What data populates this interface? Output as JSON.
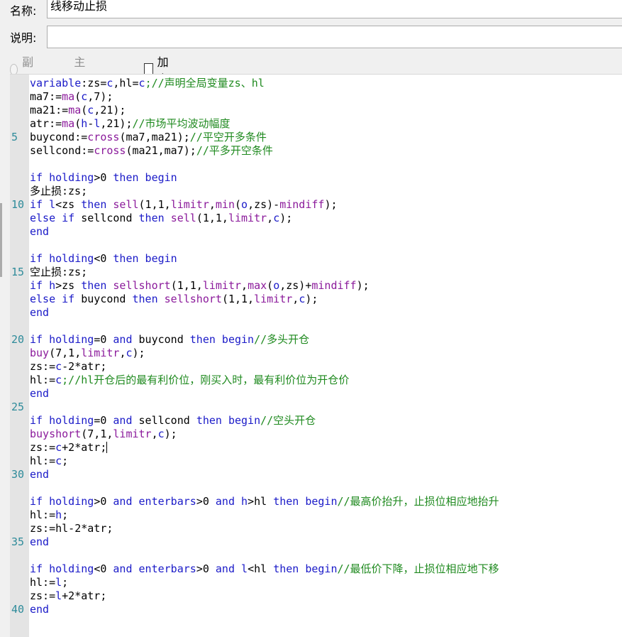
{
  "form": {
    "name_label": "名称:",
    "name_value": "线移动止损",
    "desc_label": "说明:",
    "desc_value": "",
    "opt_sub": "副图",
    "opt_main": "主图叠加",
    "opt_encrypt": "加密"
  },
  "lines": [
    {
      "n": "",
      "t": [
        [
          "k",
          "variable"
        ],
        [
          "p",
          ":zs="
        ],
        [
          "k",
          "c"
        ],
        [
          "p",
          ",hl="
        ],
        [
          "k",
          "c"
        ],
        [
          "c",
          ";//声明全局变量zs、hl"
        ]
      ]
    },
    {
      "n": "",
      "t": [
        [
          "p",
          "ma7:="
        ],
        [
          "f",
          "ma"
        ],
        [
          "p",
          "("
        ],
        [
          "k",
          "c"
        ],
        [
          "p",
          ",7);"
        ]
      ]
    },
    {
      "n": "",
      "t": [
        [
          "p",
          "ma21:="
        ],
        [
          "f",
          "ma"
        ],
        [
          "p",
          "("
        ],
        [
          "k",
          "c"
        ],
        [
          "p",
          ",21);"
        ]
      ]
    },
    {
      "n": "",
      "t": [
        [
          "p",
          "atr:="
        ],
        [
          "f",
          "ma"
        ],
        [
          "p",
          "("
        ],
        [
          "k",
          "h"
        ],
        [
          "p",
          "-"
        ],
        [
          "k",
          "l"
        ],
        [
          "p",
          ",21);"
        ],
        [
          "c",
          "//市场平均波动幅度"
        ]
      ]
    },
    {
      "n": "5",
      "t": [
        [
          "p",
          "buycond:="
        ],
        [
          "f",
          "cross"
        ],
        [
          "p",
          "(ma7,ma21);"
        ],
        [
          "c",
          "//平空开多条件"
        ]
      ]
    },
    {
      "n": "",
      "t": [
        [
          "p",
          "sellcond:="
        ],
        [
          "f",
          "cross"
        ],
        [
          "p",
          "(ma21,ma7);"
        ],
        [
          "c",
          "//平多开空条件"
        ]
      ]
    },
    {
      "n": "",
      "t": []
    },
    {
      "n": "",
      "t": [
        [
          "k",
          "if holding"
        ],
        [
          "p",
          ">0 "
        ],
        [
          "k",
          "then begin"
        ]
      ]
    },
    {
      "n": "",
      "t": [
        [
          "p",
          "多止损:zs;"
        ]
      ]
    },
    {
      "n": "10",
      "t": [
        [
          "k",
          "if l"
        ],
        [
          "p",
          "<zs "
        ],
        [
          "k",
          "then"
        ],
        [
          "p",
          " "
        ],
        [
          "f",
          "sell"
        ],
        [
          "p",
          "(1,1,"
        ],
        [
          "f",
          "limitr"
        ],
        [
          "p",
          ","
        ],
        [
          "f",
          "min"
        ],
        [
          "p",
          "("
        ],
        [
          "k",
          "o"
        ],
        [
          "p",
          ",zs)-"
        ],
        [
          "f",
          "mindiff"
        ],
        [
          "p",
          ");"
        ]
      ]
    },
    {
      "n": "",
      "t": [
        [
          "k",
          "else if"
        ],
        [
          "p",
          " sellcond "
        ],
        [
          "k",
          "then"
        ],
        [
          "p",
          " "
        ],
        [
          "f",
          "sell"
        ],
        [
          "p",
          "(1,1,"
        ],
        [
          "f",
          "limitr"
        ],
        [
          "p",
          ","
        ],
        [
          "k",
          "c"
        ],
        [
          "p",
          ");"
        ]
      ]
    },
    {
      "n": "",
      "t": [
        [
          "k",
          "end"
        ]
      ]
    },
    {
      "n": "",
      "t": []
    },
    {
      "n": "",
      "t": [
        [
          "k",
          "if holding"
        ],
        [
          "p",
          "<0 "
        ],
        [
          "k",
          "then begin"
        ]
      ]
    },
    {
      "n": "15",
      "t": [
        [
          "p",
          "空止损:zs;"
        ]
      ]
    },
    {
      "n": "",
      "t": [
        [
          "k",
          "if h"
        ],
        [
          "p",
          ">zs "
        ],
        [
          "k",
          "then"
        ],
        [
          "p",
          " "
        ],
        [
          "f",
          "sellshort"
        ],
        [
          "p",
          "(1,1,"
        ],
        [
          "f",
          "limitr"
        ],
        [
          "p",
          ","
        ],
        [
          "f",
          "max"
        ],
        [
          "p",
          "("
        ],
        [
          "k",
          "o"
        ],
        [
          "p",
          ",zs)+"
        ],
        [
          "f",
          "mindiff"
        ],
        [
          "p",
          ");"
        ]
      ]
    },
    {
      "n": "",
      "t": [
        [
          "k",
          "else if"
        ],
        [
          "p",
          " buycond "
        ],
        [
          "k",
          "then"
        ],
        [
          "p",
          " "
        ],
        [
          "f",
          "sellshort"
        ],
        [
          "p",
          "(1,1,"
        ],
        [
          "f",
          "limitr"
        ],
        [
          "p",
          ","
        ],
        [
          "k",
          "c"
        ],
        [
          "p",
          ");"
        ]
      ]
    },
    {
      "n": "",
      "t": [
        [
          "k",
          "end"
        ]
      ]
    },
    {
      "n": "",
      "t": []
    },
    {
      "n": "20",
      "t": [
        [
          "k",
          "if holding"
        ],
        [
          "p",
          "=0 "
        ],
        [
          "k",
          "and"
        ],
        [
          "p",
          " buycond "
        ],
        [
          "k",
          "then begin"
        ],
        [
          "c",
          "//多头开仓"
        ]
      ]
    },
    {
      "n": "",
      "t": [
        [
          "f",
          "buy"
        ],
        [
          "p",
          "(7,1,"
        ],
        [
          "f",
          "limitr"
        ],
        [
          "p",
          ","
        ],
        [
          "k",
          "c"
        ],
        [
          "p",
          ");"
        ]
      ]
    },
    {
      "n": "",
      "t": [
        [
          "p",
          "zs:="
        ],
        [
          "k",
          "c"
        ],
        [
          "p",
          "-2*atr;"
        ]
      ]
    },
    {
      "n": "",
      "t": [
        [
          "p",
          "hl:="
        ],
        [
          "k",
          "c"
        ],
        [
          "c",
          ";//hl开仓后的最有利价位，刚买入时，最有利价位为开仓价"
        ]
      ]
    },
    {
      "n": "",
      "t": [
        [
          "k",
          "end"
        ]
      ]
    },
    {
      "n": "25",
      "t": []
    },
    {
      "n": "",
      "t": [
        [
          "k",
          "if holding"
        ],
        [
          "p",
          "=0 "
        ],
        [
          "k",
          "and"
        ],
        [
          "p",
          " sellcond "
        ],
        [
          "k",
          "then begin"
        ],
        [
          "c",
          "//空头开仓"
        ]
      ]
    },
    {
      "n": "",
      "t": [
        [
          "f",
          "buyshort"
        ],
        [
          "p",
          "(7,1,"
        ],
        [
          "f",
          "limitr"
        ],
        [
          "p",
          ","
        ],
        [
          "k",
          "c"
        ],
        [
          "p",
          ");"
        ]
      ]
    },
    {
      "n": "",
      "t": [
        [
          "p",
          "zs:="
        ],
        [
          "k",
          "c"
        ],
        [
          "p",
          "+2*atr;"
        ],
        [
          "cur",
          ""
        ]
      ]
    },
    {
      "n": "",
      "t": [
        [
          "p",
          "hl:="
        ],
        [
          "k",
          "c"
        ],
        [
          "p",
          ";"
        ]
      ]
    },
    {
      "n": "30",
      "t": [
        [
          "k",
          "end"
        ]
      ]
    },
    {
      "n": "",
      "t": []
    },
    {
      "n": "",
      "t": [
        [
          "k",
          "if holding"
        ],
        [
          "p",
          ">0 "
        ],
        [
          "k",
          "and enterbars"
        ],
        [
          "p",
          ">0 "
        ],
        [
          "k",
          "and h"
        ],
        [
          "p",
          ">hl "
        ],
        [
          "k",
          "then begin"
        ],
        [
          "c",
          "//最高价抬升，止损位相应地抬升"
        ]
      ]
    },
    {
      "n": "",
      "t": [
        [
          "p",
          "hl:="
        ],
        [
          "k",
          "h"
        ],
        [
          "p",
          ";"
        ]
      ]
    },
    {
      "n": "",
      "t": [
        [
          "p",
          "zs:=hl-2*atr;"
        ]
      ]
    },
    {
      "n": "35",
      "t": [
        [
          "k",
          "end"
        ]
      ]
    },
    {
      "n": "",
      "t": []
    },
    {
      "n": "",
      "t": [
        [
          "k",
          "if holding"
        ],
        [
          "p",
          "<0 "
        ],
        [
          "k",
          "and enterbars"
        ],
        [
          "p",
          ">0 "
        ],
        [
          "k",
          "and l"
        ],
        [
          "p",
          "<hl "
        ],
        [
          "k",
          "then begin"
        ],
        [
          "c",
          "//最低价下降，止损位相应地下移"
        ]
      ]
    },
    {
      "n": "",
      "t": [
        [
          "p",
          "hl:="
        ],
        [
          "k",
          "l"
        ],
        [
          "p",
          ";"
        ]
      ]
    },
    {
      "n": "",
      "t": [
        [
          "p",
          "zs:="
        ],
        [
          "k",
          "l"
        ],
        [
          "p",
          "+2*atr;"
        ]
      ]
    },
    {
      "n": "40",
      "t": [
        [
          "k",
          "end"
        ]
      ]
    }
  ]
}
